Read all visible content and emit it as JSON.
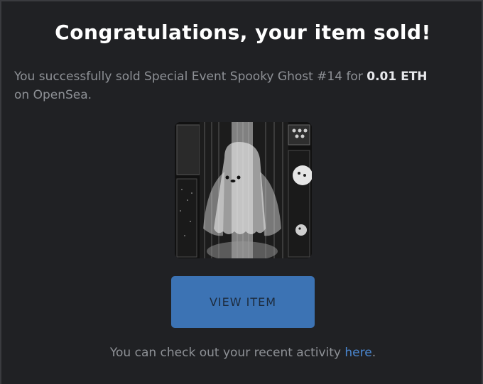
{
  "dialog": {
    "title": "Congratulations, your item sold!",
    "message_prefix": "You successfully sold Special Event Spooky Ghost #14 for ",
    "price": "0.01 ETH",
    "message_suffix": "on OpenSea.",
    "view_button_label": "VIEW ITEM",
    "footer_prefix": "You can check out your recent activity ",
    "footer_link": "here",
    "footer_suffix": "."
  },
  "nft": {
    "icon": "spooky-ghost-artwork"
  },
  "colors": {
    "background": "#202124",
    "button": "#3c73b4",
    "link": "#4a86cf",
    "muted_text": "#8e9196"
  }
}
